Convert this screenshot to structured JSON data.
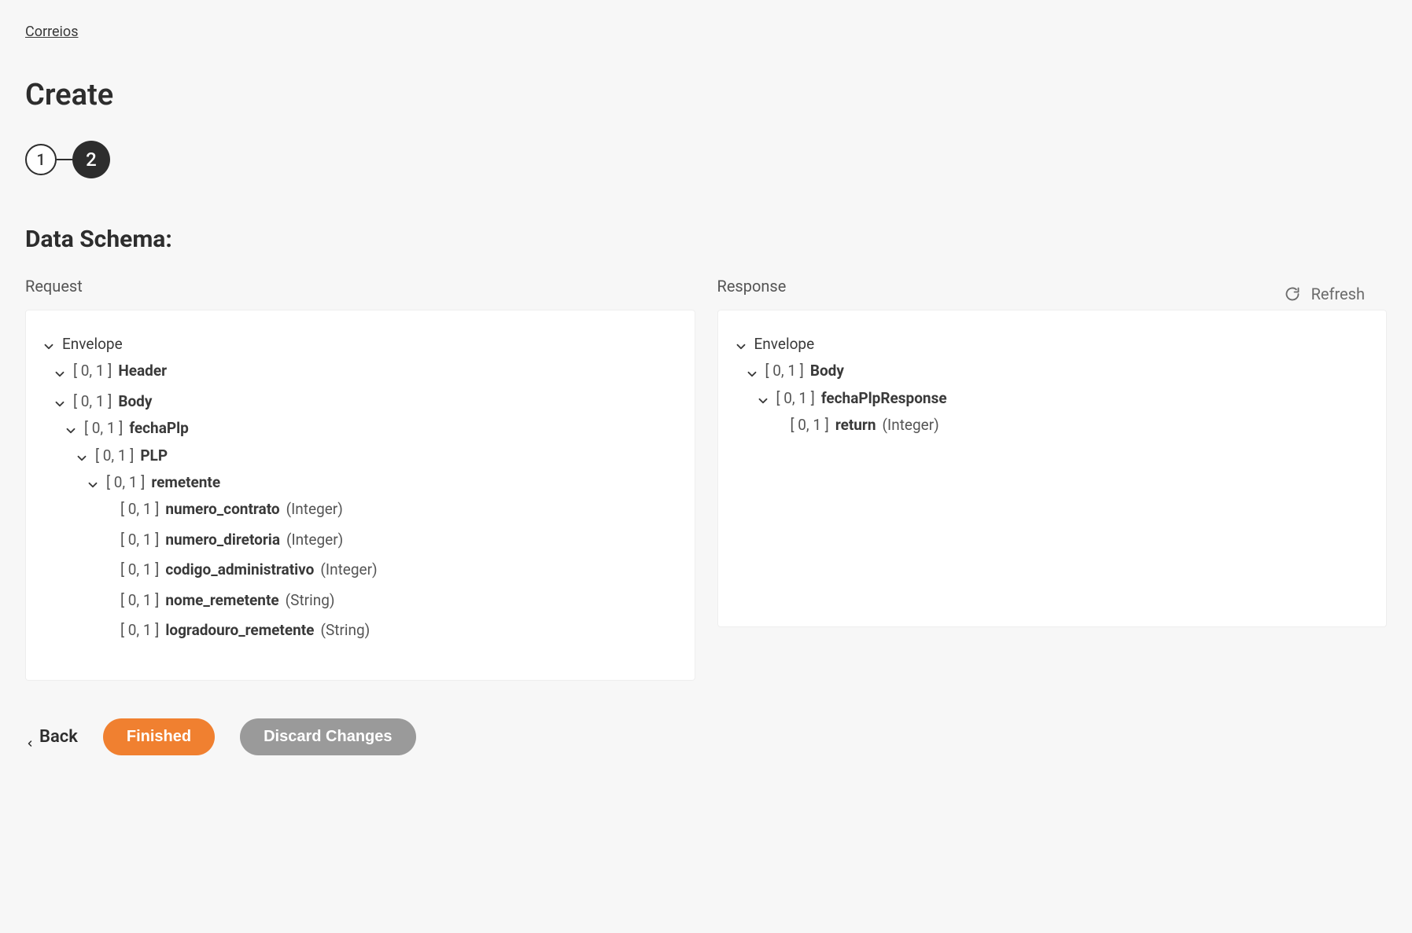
{
  "breadcrumb": "Correios",
  "page_title": "Create",
  "stepper": {
    "step1": "1",
    "step2": "2"
  },
  "section_title": "Data Schema:",
  "refresh_label": "Refresh",
  "columns": {
    "request_label": "Request",
    "response_label": "Response"
  },
  "request_tree": {
    "envelope": "Envelope",
    "header_card": "[ 0, 1 ]",
    "header_name": "Header",
    "body_card": "[ 0, 1 ]",
    "body_name": "Body",
    "fechaPlp_card": "[ 0, 1 ]",
    "fechaPlp_name": "fechaPlp",
    "plp_card": "[ 0, 1 ]",
    "plp_name": "PLP",
    "remetente_card": "[ 0, 1 ]",
    "remetente_name": "remetente",
    "leaves": [
      {
        "card": "[ 0, 1 ]",
        "name": "numero_contrato",
        "type": "(Integer)"
      },
      {
        "card": "[ 0, 1 ]",
        "name": "numero_diretoria",
        "type": "(Integer)"
      },
      {
        "card": "[ 0, 1 ]",
        "name": "codigo_administrativo",
        "type": "(Integer)"
      },
      {
        "card": "[ 0, 1 ]",
        "name": "nome_remetente",
        "type": "(String)"
      },
      {
        "card": "[ 0, 1 ]",
        "name": "logradouro_remetente",
        "type": "(String)"
      }
    ]
  },
  "response_tree": {
    "envelope": "Envelope",
    "body_card": "[ 0, 1 ]",
    "body_name": "Body",
    "fechaPlpResponse_card": "[ 0, 1 ]",
    "fechaPlpResponse_name": "fechaPlpResponse",
    "return_card": "[ 0, 1 ]",
    "return_name": "return",
    "return_type": "(Integer)"
  },
  "footer": {
    "back": "Back",
    "finished": "Finished",
    "discard": "Discard Changes"
  }
}
